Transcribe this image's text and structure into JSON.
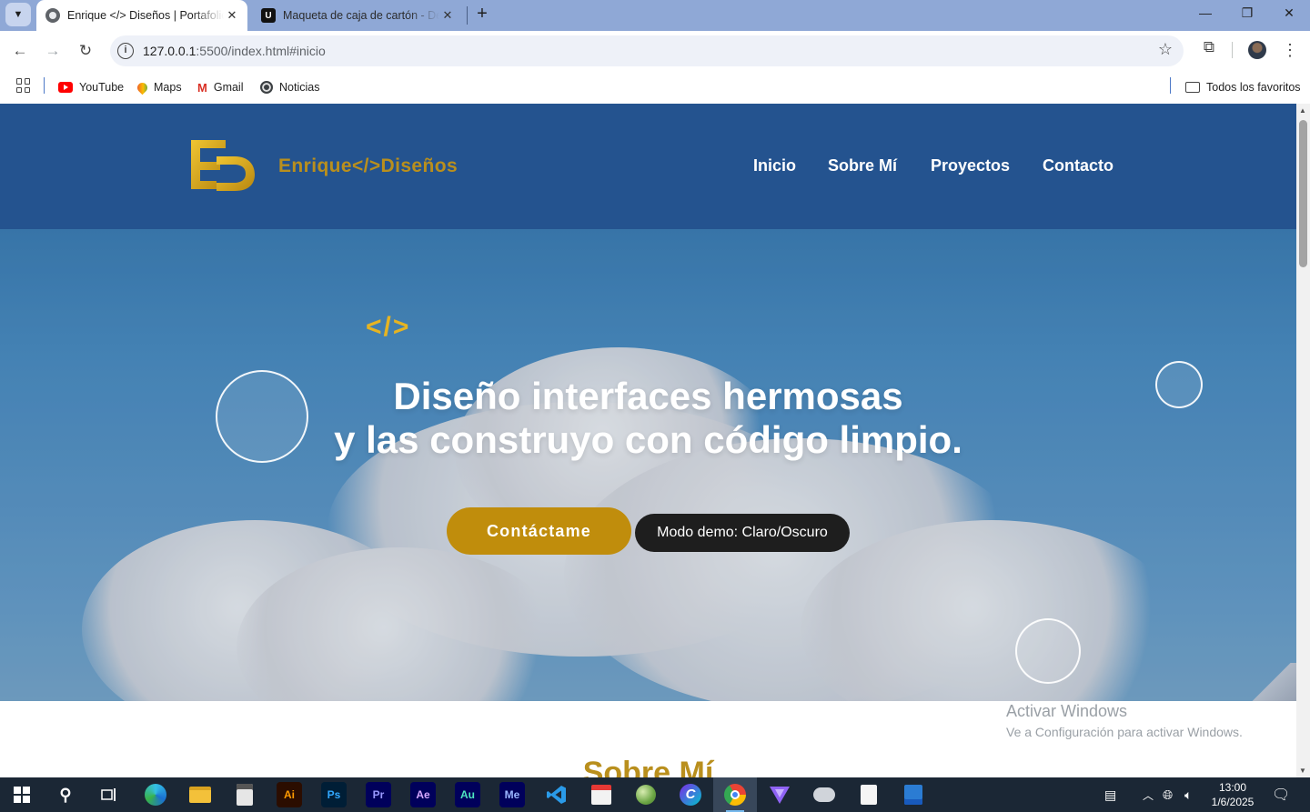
{
  "browser": {
    "tabs": [
      {
        "title": "Enrique </> Diseños | Portafolio",
        "active": true
      },
      {
        "title": "Maqueta de caja de cartón - Descarga",
        "active": false
      }
    ],
    "url_host": "127.0.0.1",
    "url_rest": ":5500/index.html#inicio",
    "bookmarks": [
      "YouTube",
      "Maps",
      "Gmail",
      "Noticias"
    ],
    "all_bookmarks_label": "Todos los favoritos"
  },
  "site": {
    "logo_text": "Enrique</>Diseños",
    "nav": [
      "Inicio",
      "Sobre Mí",
      "Proyectos",
      "Contacto"
    ],
    "hero": {
      "code_tag": "</>",
      "headline_line1": "Diseño interfaces hermosas",
      "headline_line2": "y las construyo con código limpio.",
      "cta_label": "Contáctame",
      "demo_label": "Modo demo: Claro/Oscuro"
    },
    "next_section_title": "Sobre Mí",
    "colors": {
      "header": "#24538f",
      "accent_gold": "#c08d0c",
      "logo_gold": "#b98f1d"
    }
  },
  "windows": {
    "activate_title": "Activar Windows",
    "activate_subtitle": "Ve a Configuración para activar Windows.",
    "time": "13:00",
    "date": "1/6/2025",
    "taskbar_apps": [
      "start-icon",
      "search-icon",
      "task-view-icon",
      "edge-icon",
      "file-explorer-icon",
      "calculator-icon",
      "illustrator-icon",
      "photoshop-icon",
      "premiere-icon",
      "after-effects-icon",
      "audition-icon",
      "media-encoder-icon",
      "vscode-icon",
      "calendar-icon",
      "globe-app-icon",
      "canva-icon",
      "chrome-icon",
      "vpn-icon",
      "cloud-app-icon",
      "notepad-icon",
      "document-app-icon"
    ],
    "app_labels": {
      "illustrator": "Ai",
      "photoshop": "Ps",
      "premiere": "Pr",
      "after_effects": "Ae",
      "audition": "Au",
      "media_encoder": "Me"
    }
  }
}
